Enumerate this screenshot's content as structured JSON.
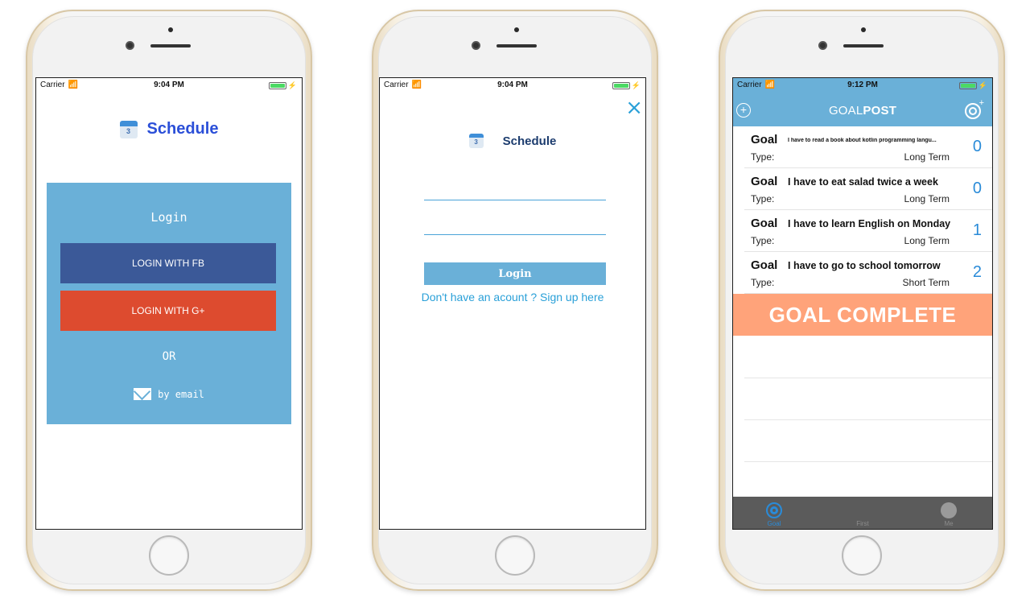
{
  "colors": {
    "accent_blue": "#6ab0d8",
    "facebook": "#3b5998",
    "google": "#dd4b2f",
    "goal_complete": "#ffa37a",
    "link": "#2aa0d8"
  },
  "screens": [
    {
      "status": {
        "carrier": "Carrier",
        "time": "9:04 PM"
      },
      "title": "Schedule",
      "calendar_day": "3",
      "login_label": "Login",
      "fb_button": "LOGIN WITH FB",
      "google_button": "LOGIN WITH G+",
      "or_label": "OR",
      "email_label": "by email"
    },
    {
      "status": {
        "carrier": "Carrier",
        "time": "9:04 PM"
      },
      "close_icon": "×",
      "title": "Schedule",
      "calendar_day": "3",
      "username_value": "",
      "password_value": "",
      "login_button": "Login",
      "signup_link": "Don't have an acount ? Sign up here"
    },
    {
      "status": {
        "carrier": "Carrier",
        "time": "9:12 PM"
      },
      "brand_prefix": "GOAL",
      "brand_suffix": "POST",
      "goals": [
        {
          "label": "Goal",
          "text": "I have to read a book about kotlin programming langu...",
          "type_label": "Type:",
          "term": "Long Term",
          "count": "0"
        },
        {
          "label": "Goal",
          "text": "I have to eat salad twice a week",
          "type_label": "Type:",
          "term": "Long Term",
          "count": "0"
        },
        {
          "label": "Goal",
          "text": "I have to learn English on Monday",
          "type_label": "Type:",
          "term": "Long Term",
          "count": "1"
        },
        {
          "label": "Goal",
          "text": "I have to go to school tomorrow",
          "type_label": "Type:",
          "term": "Short Term",
          "count": "2"
        }
      ],
      "complete_label": "GOAL COMPLETE",
      "tabs": [
        {
          "label": "Goal",
          "icon": "target-icon",
          "active": true
        },
        {
          "label": "First",
          "icon": "",
          "active": false
        },
        {
          "label": "Me",
          "icon": "person-icon",
          "active": false
        }
      ]
    }
  ]
}
